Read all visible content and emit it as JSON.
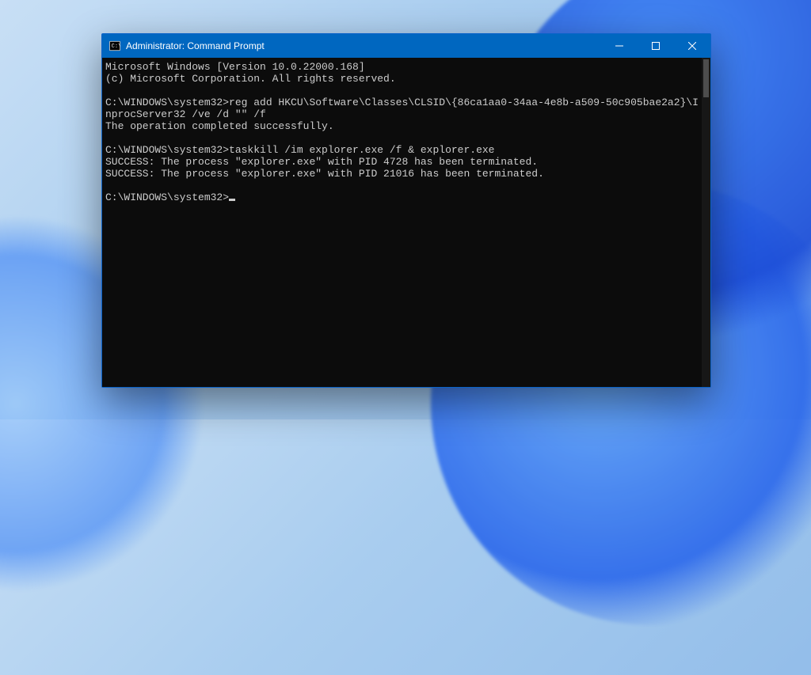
{
  "window": {
    "title": "Administrator: Command Prompt"
  },
  "terminal": {
    "lines": [
      "Microsoft Windows [Version 10.0.22000.168]",
      "(c) Microsoft Corporation. All rights reserved.",
      "",
      "C:\\WINDOWS\\system32>reg add HKCU\\Software\\Classes\\CLSID\\{86ca1aa0-34aa-4e8b-a509-50c905bae2a2}\\InprocServer32 /ve /d \"\" /f",
      "The operation completed successfully.",
      "",
      "C:\\WINDOWS\\system32>taskkill /im explorer.exe /f & explorer.exe",
      "SUCCESS: The process \"explorer.exe\" with PID 4728 has been terminated.",
      "SUCCESS: The process \"explorer.exe\" with PID 21016 has been terminated.",
      ""
    ],
    "prompt": "C:\\WINDOWS\\system32>"
  }
}
